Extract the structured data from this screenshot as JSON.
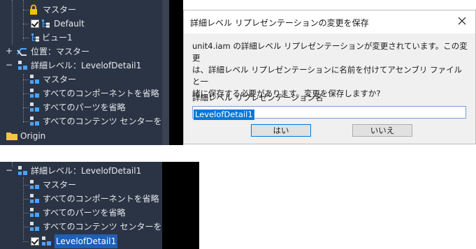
{
  "top_tree": {
    "master_top": "マスター",
    "default": "Default",
    "view1": "ビュー1",
    "position": "位置：マスター",
    "lod": "詳細レベル：LevelofDetail1",
    "lod_items": [
      "マスター",
      "すべてのコンポーネントを省略",
      "すべてのパーツを省略",
      "すべてのコンテンツ センターを省"
    ],
    "origin": "Origin"
  },
  "dialog": {
    "title": "詳細レベル リプレゼンテーションの変更を保存",
    "message_lines": [
      "unit4.iam の詳細レベル リプレゼンテーションが変更されています。この変更",
      "は、詳細レベル リプレゼンテーションに名前を付けてアセンブリ ファイルと一",
      "緒に保存する必要があります。変更を保存しますか?"
    ],
    "field_label": "詳細レベル リプレゼンテーション名",
    "field_value": "LevelofDetail1",
    "yes_label": "はい",
    "no_label": "いいえ"
  },
  "bottom_tree": {
    "lod": "詳細レベル：LevelofDetail1",
    "lod_items": [
      "マスター",
      "すべてのコンポーネントを省略",
      "すべてのパーツを省略",
      "すべてのコンテンツ センターを省",
      "LevelofDetail1"
    ]
  },
  "colors": {
    "panel_bg": "#2b3444",
    "selection": "#1e5fb8",
    "accent_blue": "#0078d7"
  }
}
